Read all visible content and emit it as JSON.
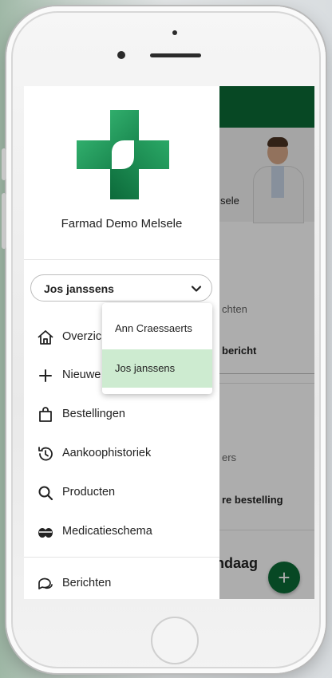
{
  "drawer": {
    "org_name": "Farmad Demo Melsele",
    "user_select": {
      "value": "Jos janssens",
      "icon": "chevron-down-icon"
    },
    "nav": [
      {
        "label": "Overzicht",
        "icon": "home-icon"
      },
      {
        "label": "Nieuwe",
        "icon": "plus-icon"
      },
      {
        "label": "Bestellingen",
        "icon": "shopping-bag-icon"
      },
      {
        "label": "Aankoophistoriek",
        "icon": "history-icon"
      },
      {
        "label": "Producten",
        "icon": "search-icon"
      },
      {
        "label": "Medicatieschema",
        "icon": "pills-icon"
      },
      {
        "label": "Berichten",
        "icon": "chat-icon"
      }
    ]
  },
  "dropdown": {
    "options": [
      {
        "label": "Ann Craessaerts",
        "selected": false
      },
      {
        "label": "Jos janssens",
        "selected": true
      }
    ]
  },
  "background": {
    "hero_text": "sele",
    "row1_sub": "chten",
    "row1_main": "bericht",
    "row2_sub": "ers",
    "row2_main": "re bestelling",
    "section_title": "ndaag",
    "fab_label": "+"
  },
  "colors": {
    "brand_green": "#0b6b36",
    "logo_green": "#1f9a5c",
    "selected_option": "#cdebd0"
  }
}
